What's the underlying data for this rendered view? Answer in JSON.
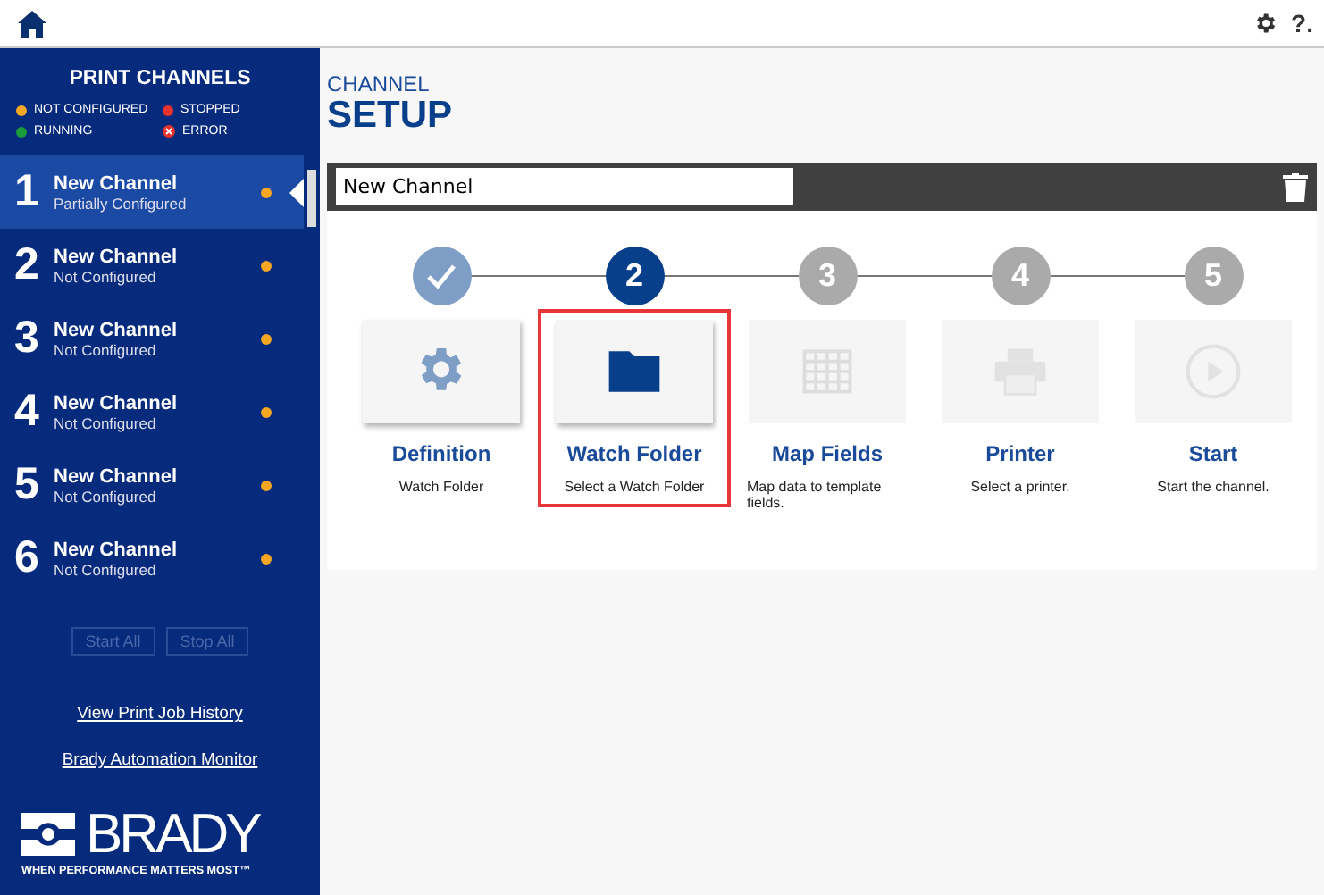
{
  "sidebar": {
    "title": "PRINT CHANNELS",
    "legend": [
      {
        "label": "NOT CONFIGURED",
        "color": "#f5a623",
        "kind": "dot"
      },
      {
        "label": "STOPPED",
        "color": "#e8332f",
        "kind": "dot"
      },
      {
        "label": "RUNNING",
        "color": "#1a9a3a",
        "kind": "dot"
      },
      {
        "label": "ERROR",
        "color": "#e8332f",
        "kind": "cross"
      }
    ],
    "channels": [
      {
        "number": "1",
        "name": "New Channel",
        "status": "Partially Configured",
        "color": "#f5a623",
        "selected": true
      },
      {
        "number": "2",
        "name": "New Channel",
        "status": "Not Configured",
        "color": "#f5a623",
        "selected": false
      },
      {
        "number": "3",
        "name": "New Channel",
        "status": "Not Configured",
        "color": "#f5a623",
        "selected": false
      },
      {
        "number": "4",
        "name": "New Channel",
        "status": "Not Configured",
        "color": "#f5a623",
        "selected": false
      },
      {
        "number": "5",
        "name": "New Channel",
        "status": "Not Configured",
        "color": "#f5a623",
        "selected": false
      },
      {
        "number": "6",
        "name": "New Channel",
        "status": "Not Configured",
        "color": "#f5a623",
        "selected": false
      }
    ],
    "buttons": [
      {
        "label": "Start All",
        "disabled": true
      },
      {
        "label": "Stop All",
        "disabled": true
      }
    ],
    "links": [
      "View Print Job History",
      "Brady Automation Monitor"
    ],
    "logo": {
      "name": "BRADY",
      "tagline": "WHEN PERFORMANCE MATTERS MOST™"
    }
  },
  "header": {
    "overline": "CHANNEL",
    "title": "SETUP",
    "help": "?."
  },
  "channel_name": {
    "value": "New Channel"
  },
  "steps": [
    {
      "kind": "gear",
      "title": "Definition",
      "description": "Watch Folder",
      "completed": true,
      "selected": false
    },
    {
      "kind": "folder",
      "number": "2",
      "title": "Watch Folder",
      "description": "Select a Watch Folder",
      "completed": false,
      "active": true,
      "selected": true
    },
    {
      "kind": "grid",
      "number": "3",
      "title": "Map Fields",
      "description": "Map data to template fields.",
      "completed": false,
      "active": false,
      "selected": false
    },
    {
      "kind": "printer",
      "number": "4",
      "title": "Printer",
      "description": "Select a printer.",
      "completed": false,
      "active": false,
      "selected": false
    },
    {
      "kind": "play",
      "number": "5",
      "title": "Start",
      "description": "Start the channel.",
      "completed": false,
      "active": false,
      "selected": false
    }
  ]
}
